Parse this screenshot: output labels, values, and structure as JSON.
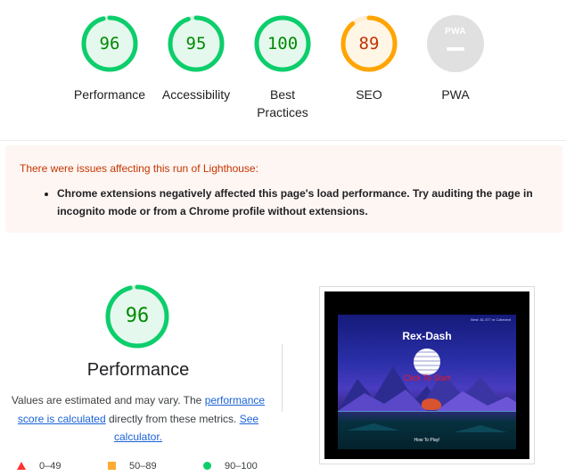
{
  "categories": [
    {
      "label": "Performance",
      "score": "96",
      "status": "pass",
      "fraction": 0.96
    },
    {
      "label": "Accessibility",
      "score": "95",
      "status": "pass",
      "fraction": 0.95
    },
    {
      "label": "Best Practices",
      "score": "100",
      "status": "pass",
      "fraction": 1.0
    },
    {
      "label": "SEO",
      "score": "89",
      "status": "average",
      "fraction": 0.89
    },
    {
      "label": "PWA",
      "score": "",
      "status": "na",
      "badge_text": "PWA"
    }
  ],
  "warning": {
    "title": "There were issues affecting this run of Lighthouse:",
    "items": [
      "Chrome extensions negatively affected this page's load performance. Try auditing the page in incognito mode or from a Chrome profile without extensions."
    ]
  },
  "performance": {
    "score": "96",
    "fraction": 0.96,
    "title": "Performance",
    "desc_prefix": "Values are estimated and may vary. The",
    "calc_link": "performance score is calculated",
    "desc_middle": "directly from these metrics.",
    "see_link": "See calculator."
  },
  "legend": {
    "fail": "0–49",
    "average": "50–89",
    "pass": "90–100"
  },
  "screenshot": {
    "game_title": "Rex-Dash",
    "hud": "Best: 81   377 m   Collected",
    "cta": "Click To Start",
    "howto": "How To Play!"
  },
  "colors": {
    "pass": "#0cce6b",
    "pass_text": "#008a00",
    "average": "#ffa400",
    "average_text": "#c33300",
    "na": "#e0e0e0",
    "fail": "#ff3333"
  }
}
